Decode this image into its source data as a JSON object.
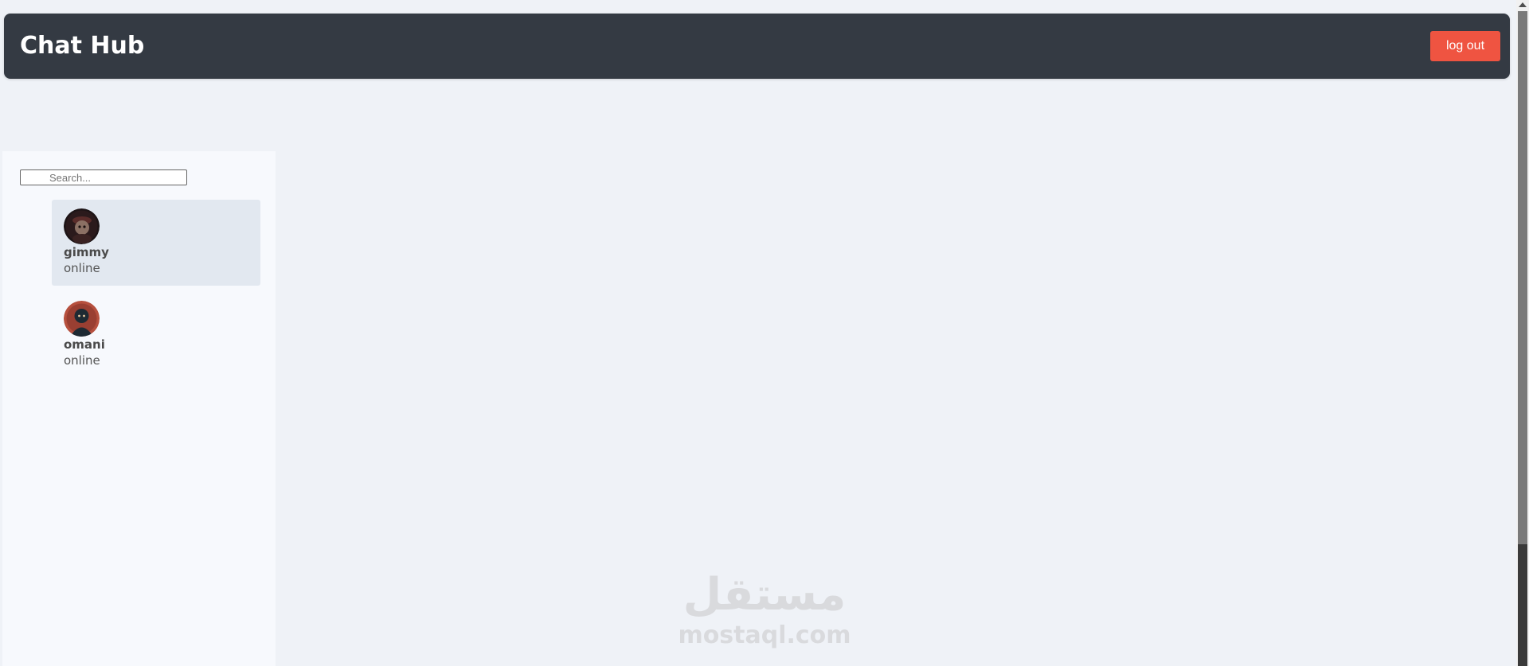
{
  "header": {
    "title": "Chat Hub",
    "logout_label": "log out"
  },
  "colors": {
    "header_bg": "#343a43",
    "logout_bg": "#ef5441",
    "page_bg": "#eff2f7",
    "sidebar_bg": "#f7f9fd",
    "active_item_bg": "#e2e8f0"
  },
  "search": {
    "placeholder": "Search...",
    "value": ""
  },
  "users": [
    {
      "name": "gimmy",
      "status": "online",
      "avatar_icon": "user-avatar-icon",
      "active": true
    },
    {
      "name": "omani",
      "status": "online",
      "avatar_icon": "user-avatar-icon",
      "active": false
    }
  ],
  "watermark": {
    "arabic": "مستقل",
    "latin": "mostaql.com"
  }
}
